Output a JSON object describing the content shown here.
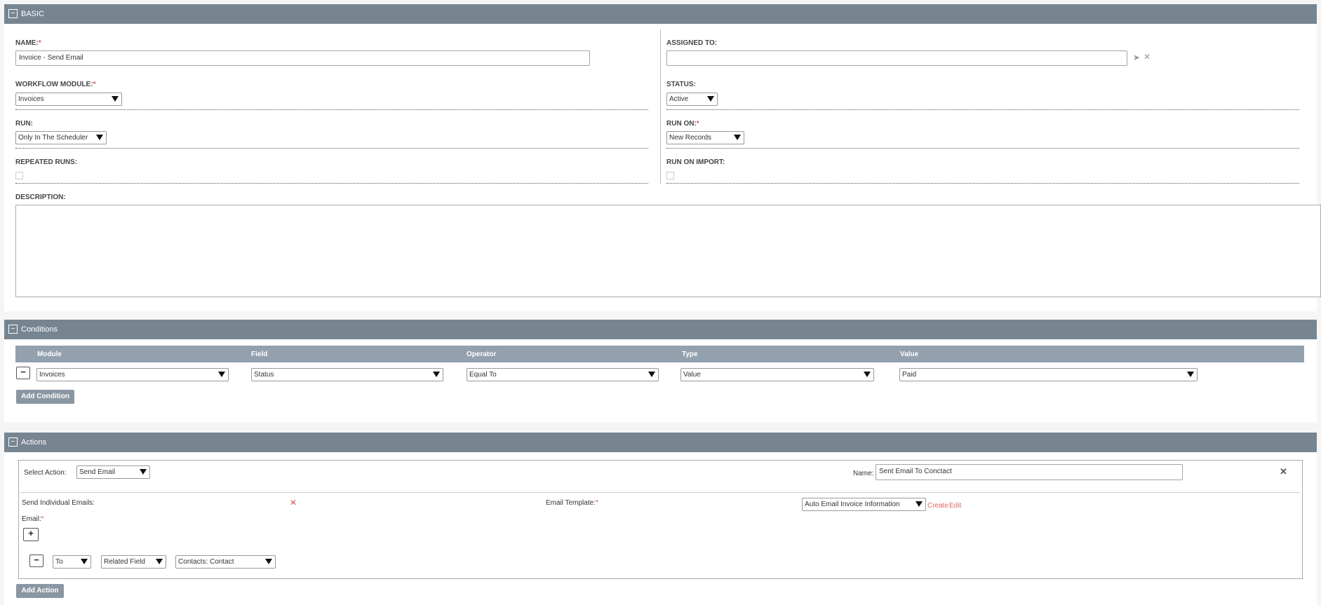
{
  "basic": {
    "header": "BASIC",
    "name_label": "NAME:",
    "name_value": "Invoice  - Send Email",
    "assigned_label": "ASSIGNED TO:",
    "assigned_value": "",
    "module_label": "WORKFLOW MODULE:",
    "module_value": "Invoices",
    "status_label": "STATUS:",
    "status_value": "Active",
    "run_label": "RUN:",
    "run_value": "Only In The Scheduler",
    "run_on_label": "RUN ON:",
    "run_on_value": "New Records",
    "repeated_label": "REPEATED RUNS:",
    "run_import_label": "RUN ON IMPORT:",
    "description_label": "DESCRIPTION:",
    "required_mark": "*"
  },
  "conditions": {
    "header": "Conditions",
    "columns": [
      "Module",
      "Field",
      "Operator",
      "Type",
      "Value"
    ],
    "row": {
      "module": "Invoices",
      "field": "Status",
      "operator": "Equal To",
      "type": "Value",
      "value": "Paid"
    },
    "add_label": "Add Condition"
  },
  "actions": {
    "header": "Actions",
    "select_action_label": "Select Action:",
    "select_action_value": "Send Email",
    "name_label": "Name:",
    "name_value": "Sent Email To Conctact",
    "send_individual_label": "Send Individual Emails:",
    "email_template_label": "Email Template:",
    "email_template_value": "Auto Email Invoice Information",
    "create_link": "Create",
    "edit_link": "Edit",
    "email_label": "Email:",
    "recipient_type": "To",
    "recipient_source": "Related Field",
    "recipient_field": "Contacts: Contact",
    "add_label": "Add Action"
  }
}
